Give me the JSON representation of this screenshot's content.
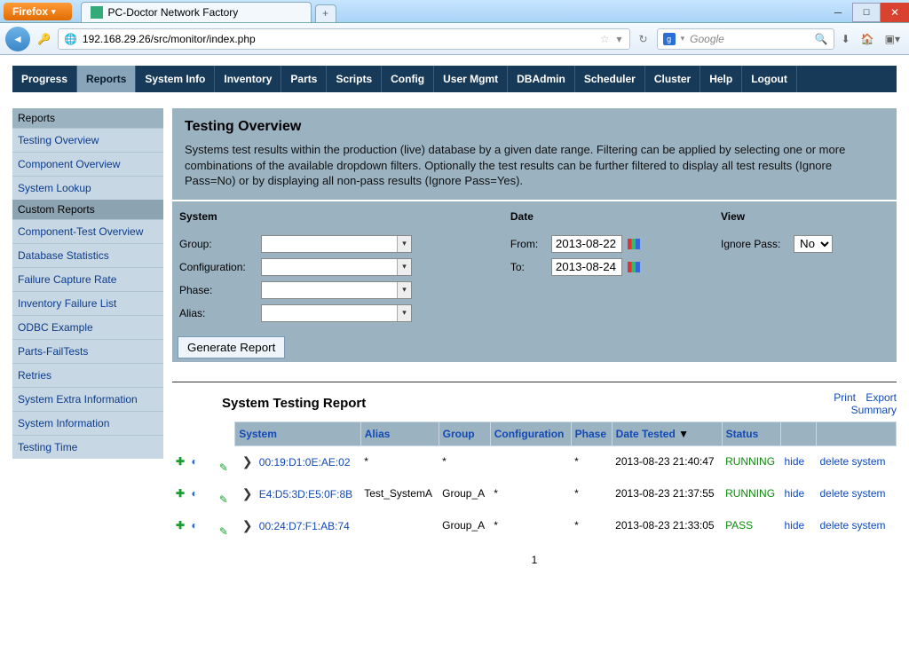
{
  "browser": {
    "menu_label": "Firefox",
    "tab_title": "PC-Doctor Network Factory",
    "url": "192.168.29.26/src/monitor/index.php",
    "search_placeholder": "Google",
    "searchengine_label": "g"
  },
  "topnav": [
    "Progress",
    "Reports",
    "System Info",
    "Inventory",
    "Parts",
    "Scripts",
    "Config",
    "User Mgmt",
    "DBAdmin",
    "Scheduler",
    "Cluster",
    "Help",
    "Logout"
  ],
  "topnav_active": "Reports",
  "sidebar": {
    "sections": [
      {
        "header": "Reports",
        "items": [
          "Testing Overview",
          "Component Overview",
          "System Lookup"
        ]
      },
      {
        "header": "Custom Reports",
        "items": [
          "Component-Test Overview",
          "Database Statistics",
          "Failure Capture Rate",
          "Inventory Failure List",
          "ODBC Example",
          "Parts-FailTests",
          "Retries",
          "System Extra Information",
          "System Information",
          "Testing Time"
        ]
      }
    ]
  },
  "panel": {
    "title": "Testing Overview",
    "desc": "Systems test results within the production (live) database by a given date range. Filtering can be applied by selecting one or more combinations of the available dropdown filters. Optionally the test results can be further filtered to display all test results (Ignore Pass=No) or by displaying all non-pass results (Ignore Pass=Yes)."
  },
  "filters": {
    "system_header": "System",
    "date_header": "Date",
    "view_header": "View",
    "labels": {
      "group": "Group:",
      "config": "Configuration:",
      "phase": "Phase:",
      "alias": "Alias:",
      "from": "From:",
      "to": "To:",
      "ignore": "Ignore Pass:"
    },
    "from_value": "2013-08-22",
    "to_value": "2013-08-24",
    "ignore_value": "No",
    "generate_label": "Generate Report"
  },
  "report": {
    "title": "System Testing Report",
    "links": {
      "print": "Print",
      "export": "Export",
      "summary": "Summary"
    },
    "cols": {
      "system": "System",
      "alias": "Alias",
      "group": "Group",
      "config": "Configuration",
      "phase": "Phase",
      "date": "Date Tested",
      "status": "Status"
    },
    "rows": [
      {
        "mac": "00:19:D1:0E:AE:02",
        "alias": "*",
        "group": "*",
        "config": "",
        "phase": "*",
        "date": "2013-08-23 21:40:47",
        "status": "RUNNING",
        "status_class": "st-run"
      },
      {
        "mac": "E4:D5:3D:E5:0F:8B",
        "alias": "Test_SystemA",
        "group": "Group_A",
        "config": "*",
        "phase": "*",
        "date": "2013-08-23 21:37:55",
        "status": "RUNNING",
        "status_class": "st-run"
      },
      {
        "mac": "00:24:D7:F1:AB:74",
        "alias": "",
        "group": "Group_A",
        "config": "*",
        "phase": "*",
        "date": "2013-08-23 21:33:05",
        "status": "PASS",
        "status_class": "st-pass"
      }
    ],
    "actions": {
      "hide": "hide",
      "delete": "delete system"
    },
    "page_num": "1"
  }
}
